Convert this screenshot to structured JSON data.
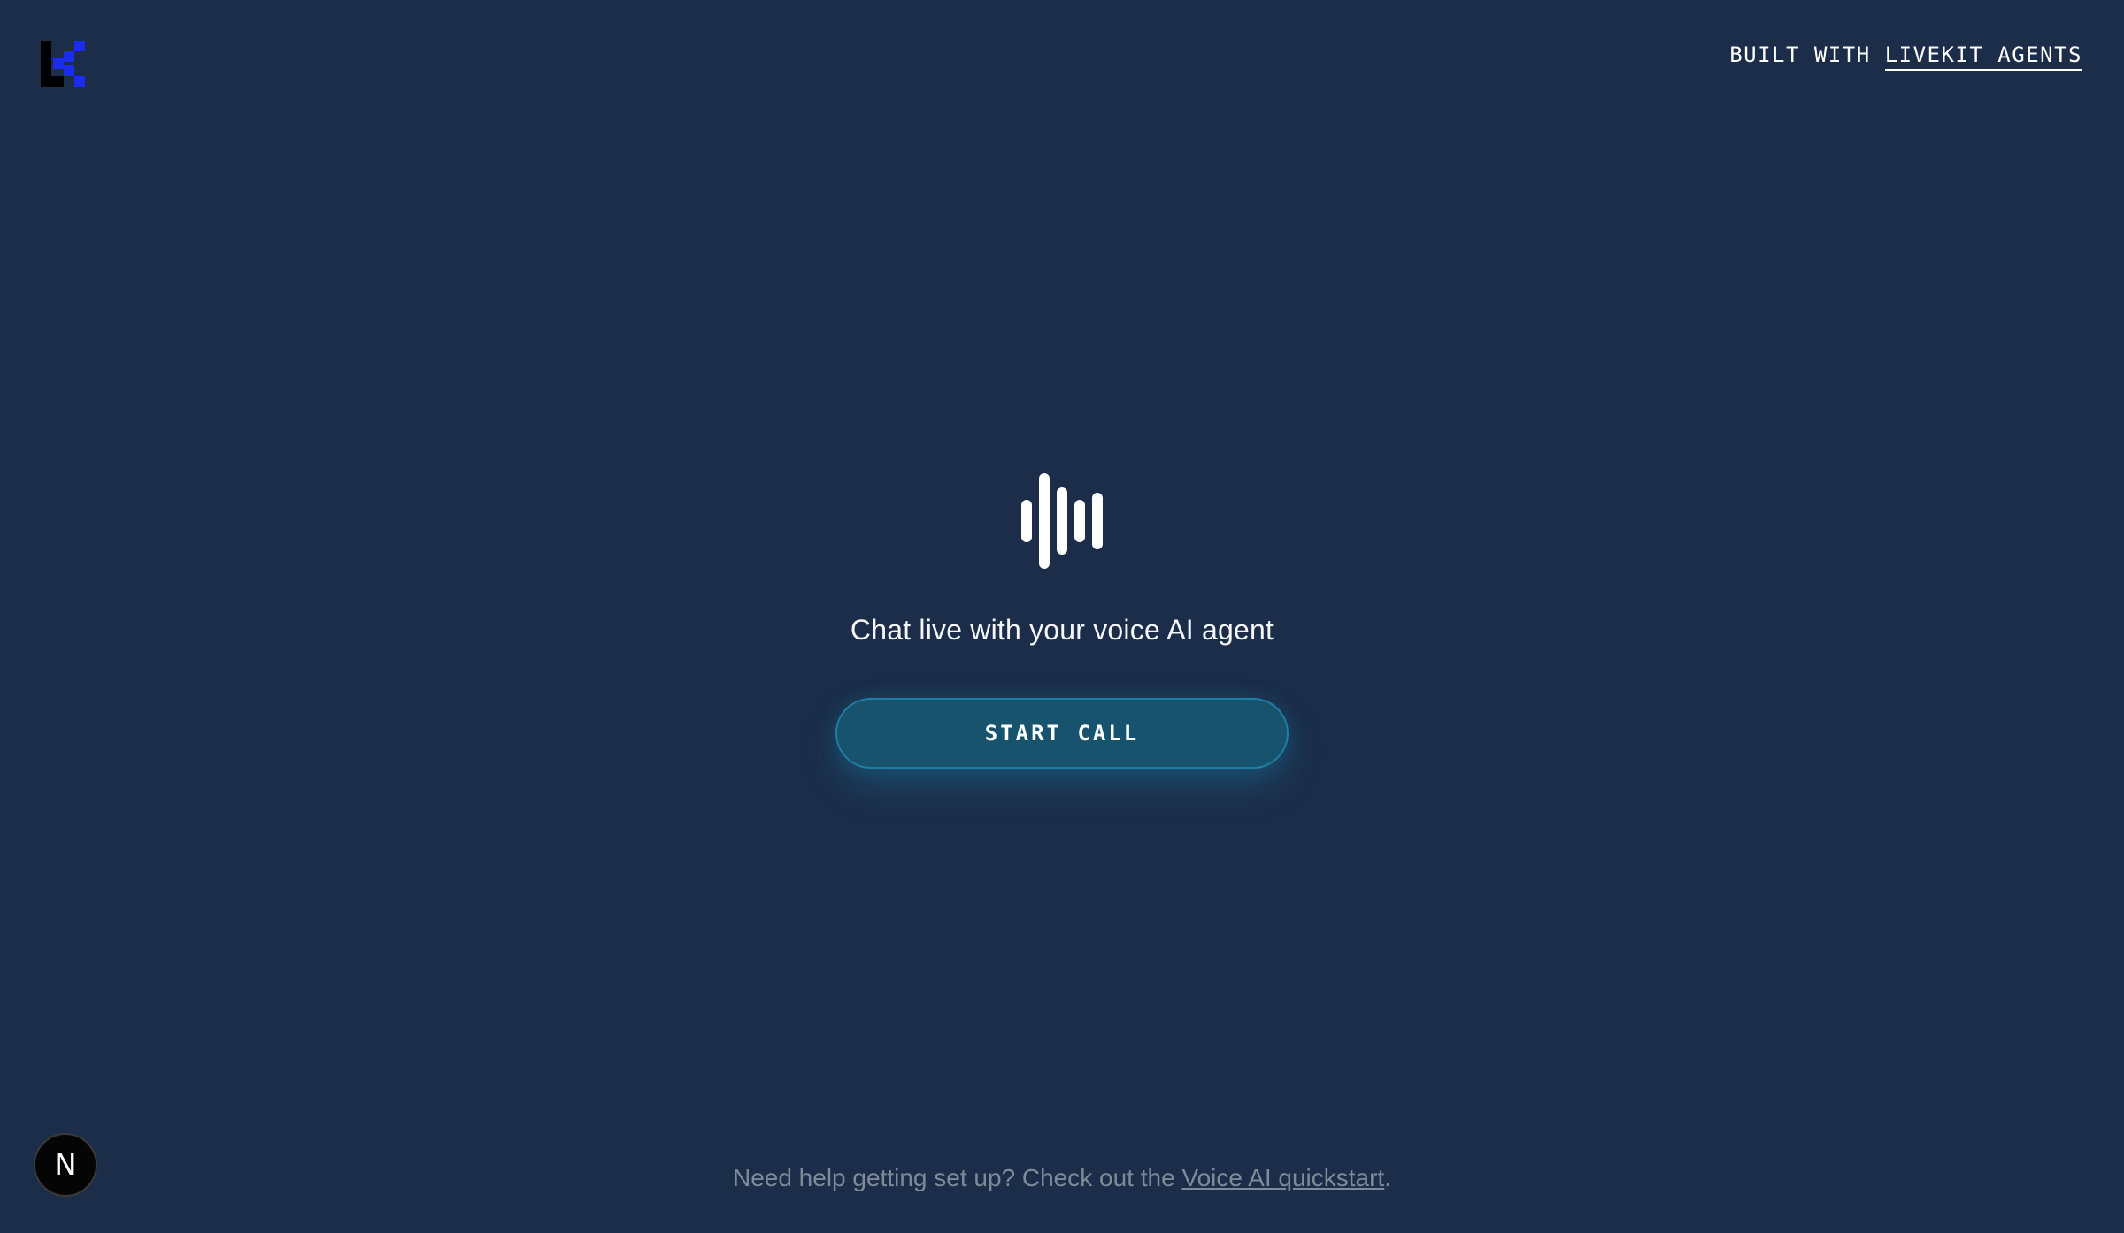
{
  "header": {
    "logo_icon": "livekit-logo-icon",
    "credit_prefix": "BUILT WITH",
    "credit_link": "LIVEKIT AGENTS"
  },
  "main": {
    "voice_icon": "audio-waveform-icon",
    "headline": "Chat live with your voice AI agent",
    "start_call_label": "START CALL"
  },
  "footer": {
    "help_prefix": "Need help getting set up? Check out the",
    "help_link": "Voice AI quickstart",
    "help_suffix": "."
  },
  "badge": {
    "label": "N",
    "icon": "nextjs-dev-indicator-icon"
  },
  "colors": {
    "background": "#1b2d48",
    "button_fill": "#18536e",
    "button_border": "#1f7da6",
    "logo_blue": "#1a2cf0",
    "muted_text": "#7f8a99"
  }
}
